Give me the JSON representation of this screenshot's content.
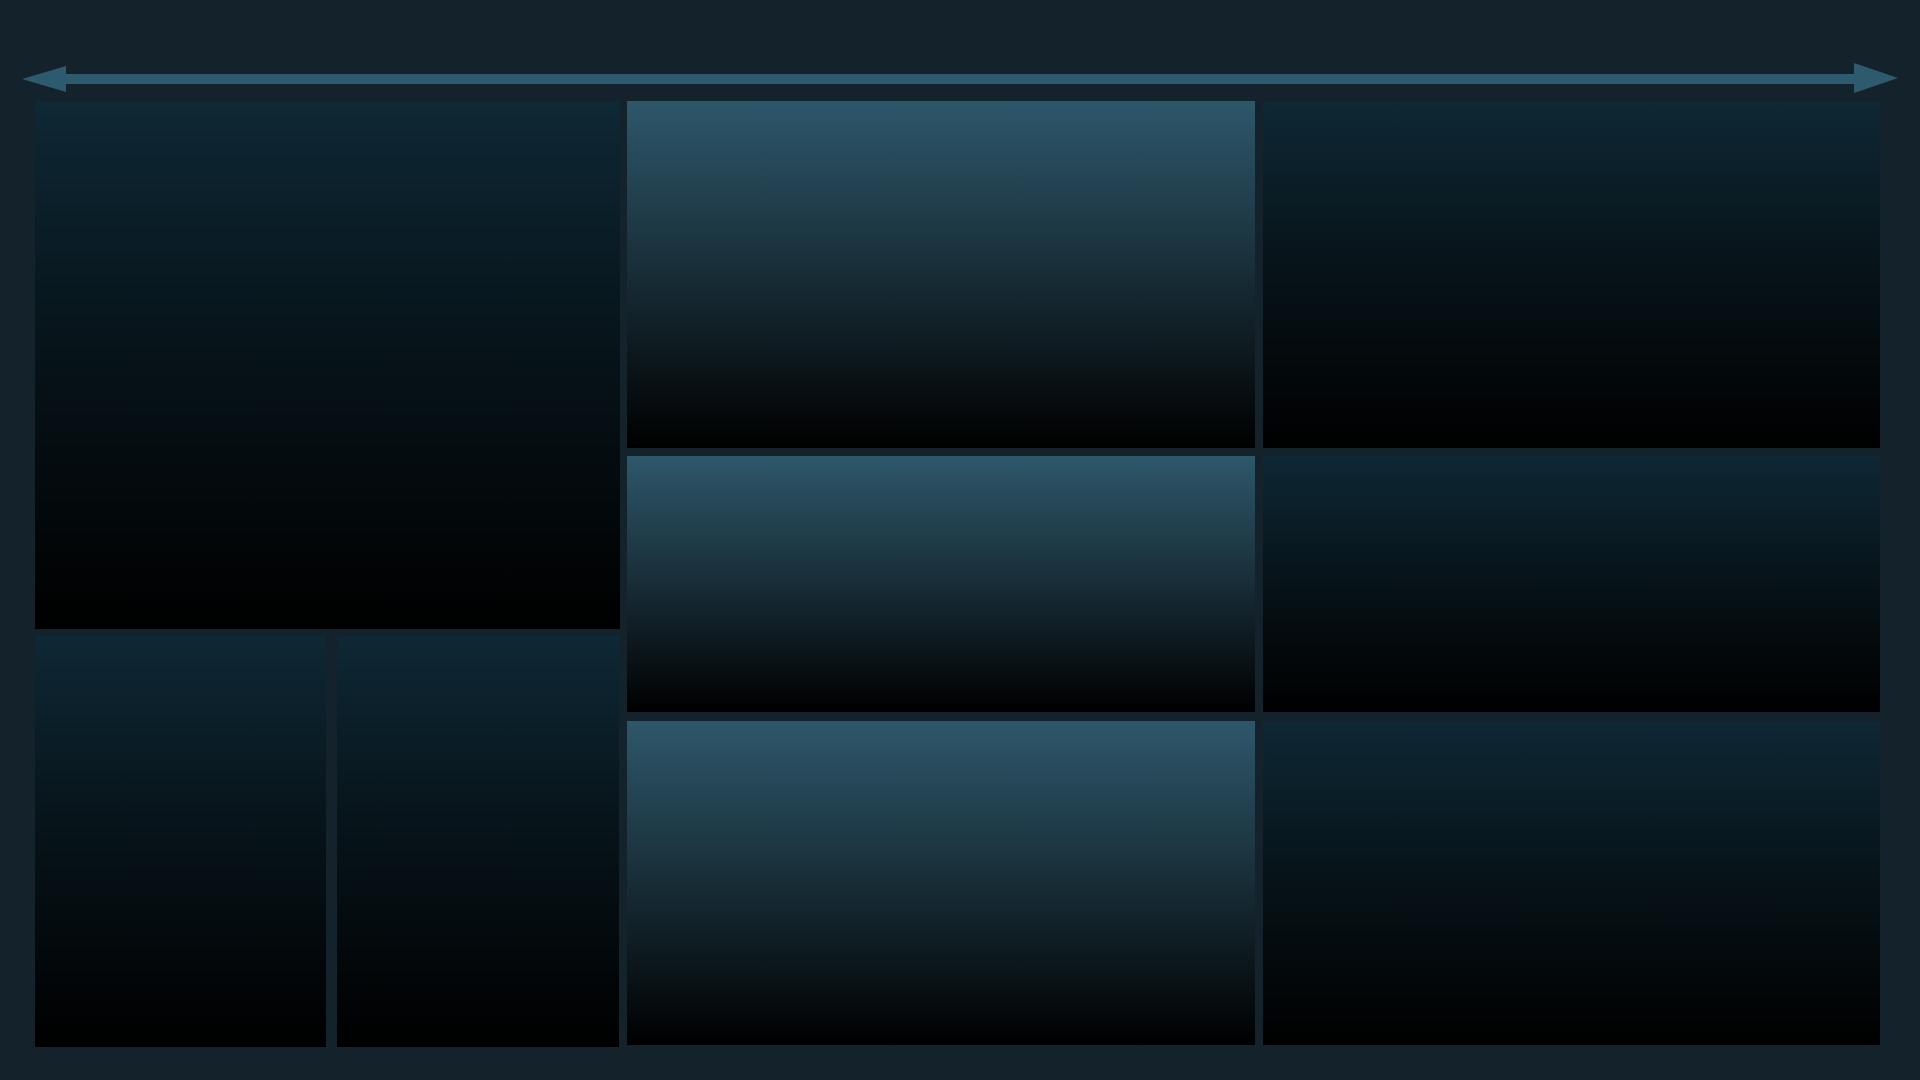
{
  "colors": {
    "background": "#13222b",
    "arrow": "#2e5a70",
    "tile_dark_top": "#0e2835",
    "tile_light_top": "#2e576b",
    "tile_bottom": "#000000"
  },
  "icons": {
    "top_indicator": "double-headed-arrow-icon"
  },
  "tiles": [
    {
      "id": "left-large",
      "style": "dark"
    },
    {
      "id": "left-bottom-left",
      "style": "dark"
    },
    {
      "id": "left-bottom-right",
      "style": "dark"
    },
    {
      "id": "middle-top",
      "style": "light"
    },
    {
      "id": "middle-center",
      "style": "light"
    },
    {
      "id": "middle-bottom",
      "style": "light"
    },
    {
      "id": "right-top",
      "style": "dark"
    },
    {
      "id": "right-center",
      "style": "dark"
    },
    {
      "id": "right-bottom",
      "style": "dark"
    }
  ]
}
